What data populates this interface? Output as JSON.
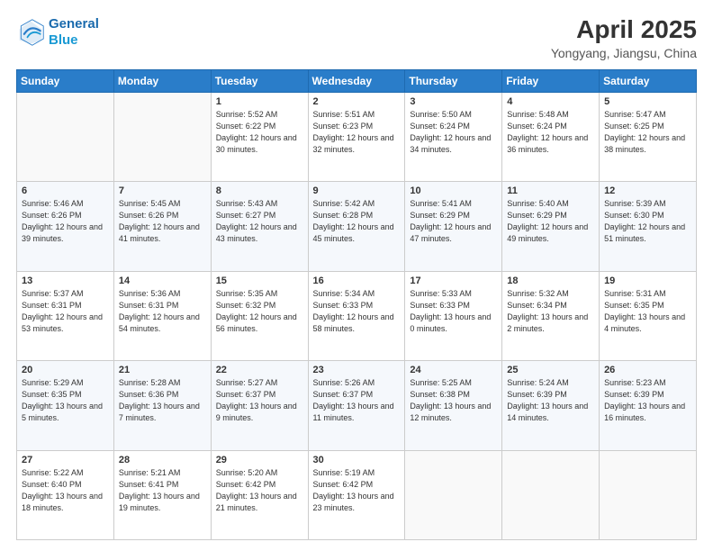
{
  "logo": {
    "line1": "General",
    "line2": "Blue"
  },
  "title": "April 2025",
  "subtitle": "Yongyang, Jiangsu, China",
  "weekdays": [
    "Sunday",
    "Monday",
    "Tuesday",
    "Wednesday",
    "Thursday",
    "Friday",
    "Saturday"
  ],
  "weeks": [
    [
      {
        "day": "",
        "sunrise": "",
        "sunset": "",
        "daylight": ""
      },
      {
        "day": "",
        "sunrise": "",
        "sunset": "",
        "daylight": ""
      },
      {
        "day": "1",
        "sunrise": "Sunrise: 5:52 AM",
        "sunset": "Sunset: 6:22 PM",
        "daylight": "Daylight: 12 hours and 30 minutes."
      },
      {
        "day": "2",
        "sunrise": "Sunrise: 5:51 AM",
        "sunset": "Sunset: 6:23 PM",
        "daylight": "Daylight: 12 hours and 32 minutes."
      },
      {
        "day": "3",
        "sunrise": "Sunrise: 5:50 AM",
        "sunset": "Sunset: 6:24 PM",
        "daylight": "Daylight: 12 hours and 34 minutes."
      },
      {
        "day": "4",
        "sunrise": "Sunrise: 5:48 AM",
        "sunset": "Sunset: 6:24 PM",
        "daylight": "Daylight: 12 hours and 36 minutes."
      },
      {
        "day": "5",
        "sunrise": "Sunrise: 5:47 AM",
        "sunset": "Sunset: 6:25 PM",
        "daylight": "Daylight: 12 hours and 38 minutes."
      }
    ],
    [
      {
        "day": "6",
        "sunrise": "Sunrise: 5:46 AM",
        "sunset": "Sunset: 6:26 PM",
        "daylight": "Daylight: 12 hours and 39 minutes."
      },
      {
        "day": "7",
        "sunrise": "Sunrise: 5:45 AM",
        "sunset": "Sunset: 6:26 PM",
        "daylight": "Daylight: 12 hours and 41 minutes."
      },
      {
        "day": "8",
        "sunrise": "Sunrise: 5:43 AM",
        "sunset": "Sunset: 6:27 PM",
        "daylight": "Daylight: 12 hours and 43 minutes."
      },
      {
        "day": "9",
        "sunrise": "Sunrise: 5:42 AM",
        "sunset": "Sunset: 6:28 PM",
        "daylight": "Daylight: 12 hours and 45 minutes."
      },
      {
        "day": "10",
        "sunrise": "Sunrise: 5:41 AM",
        "sunset": "Sunset: 6:29 PM",
        "daylight": "Daylight: 12 hours and 47 minutes."
      },
      {
        "day": "11",
        "sunrise": "Sunrise: 5:40 AM",
        "sunset": "Sunset: 6:29 PM",
        "daylight": "Daylight: 12 hours and 49 minutes."
      },
      {
        "day": "12",
        "sunrise": "Sunrise: 5:39 AM",
        "sunset": "Sunset: 6:30 PM",
        "daylight": "Daylight: 12 hours and 51 minutes."
      }
    ],
    [
      {
        "day": "13",
        "sunrise": "Sunrise: 5:37 AM",
        "sunset": "Sunset: 6:31 PM",
        "daylight": "Daylight: 12 hours and 53 minutes."
      },
      {
        "day": "14",
        "sunrise": "Sunrise: 5:36 AM",
        "sunset": "Sunset: 6:31 PM",
        "daylight": "Daylight: 12 hours and 54 minutes."
      },
      {
        "day": "15",
        "sunrise": "Sunrise: 5:35 AM",
        "sunset": "Sunset: 6:32 PM",
        "daylight": "Daylight: 12 hours and 56 minutes."
      },
      {
        "day": "16",
        "sunrise": "Sunrise: 5:34 AM",
        "sunset": "Sunset: 6:33 PM",
        "daylight": "Daylight: 12 hours and 58 minutes."
      },
      {
        "day": "17",
        "sunrise": "Sunrise: 5:33 AM",
        "sunset": "Sunset: 6:33 PM",
        "daylight": "Daylight: 13 hours and 0 minutes."
      },
      {
        "day": "18",
        "sunrise": "Sunrise: 5:32 AM",
        "sunset": "Sunset: 6:34 PM",
        "daylight": "Daylight: 13 hours and 2 minutes."
      },
      {
        "day": "19",
        "sunrise": "Sunrise: 5:31 AM",
        "sunset": "Sunset: 6:35 PM",
        "daylight": "Daylight: 13 hours and 4 minutes."
      }
    ],
    [
      {
        "day": "20",
        "sunrise": "Sunrise: 5:29 AM",
        "sunset": "Sunset: 6:35 PM",
        "daylight": "Daylight: 13 hours and 5 minutes."
      },
      {
        "day": "21",
        "sunrise": "Sunrise: 5:28 AM",
        "sunset": "Sunset: 6:36 PM",
        "daylight": "Daylight: 13 hours and 7 minutes."
      },
      {
        "day": "22",
        "sunrise": "Sunrise: 5:27 AM",
        "sunset": "Sunset: 6:37 PM",
        "daylight": "Daylight: 13 hours and 9 minutes."
      },
      {
        "day": "23",
        "sunrise": "Sunrise: 5:26 AM",
        "sunset": "Sunset: 6:37 PM",
        "daylight": "Daylight: 13 hours and 11 minutes."
      },
      {
        "day": "24",
        "sunrise": "Sunrise: 5:25 AM",
        "sunset": "Sunset: 6:38 PM",
        "daylight": "Daylight: 13 hours and 12 minutes."
      },
      {
        "day": "25",
        "sunrise": "Sunrise: 5:24 AM",
        "sunset": "Sunset: 6:39 PM",
        "daylight": "Daylight: 13 hours and 14 minutes."
      },
      {
        "day": "26",
        "sunrise": "Sunrise: 5:23 AM",
        "sunset": "Sunset: 6:39 PM",
        "daylight": "Daylight: 13 hours and 16 minutes."
      }
    ],
    [
      {
        "day": "27",
        "sunrise": "Sunrise: 5:22 AM",
        "sunset": "Sunset: 6:40 PM",
        "daylight": "Daylight: 13 hours and 18 minutes."
      },
      {
        "day": "28",
        "sunrise": "Sunrise: 5:21 AM",
        "sunset": "Sunset: 6:41 PM",
        "daylight": "Daylight: 13 hours and 19 minutes."
      },
      {
        "day": "29",
        "sunrise": "Sunrise: 5:20 AM",
        "sunset": "Sunset: 6:42 PM",
        "daylight": "Daylight: 13 hours and 21 minutes."
      },
      {
        "day": "30",
        "sunrise": "Sunrise: 5:19 AM",
        "sunset": "Sunset: 6:42 PM",
        "daylight": "Daylight: 13 hours and 23 minutes."
      },
      {
        "day": "",
        "sunrise": "",
        "sunset": "",
        "daylight": ""
      },
      {
        "day": "",
        "sunrise": "",
        "sunset": "",
        "daylight": ""
      },
      {
        "day": "",
        "sunrise": "",
        "sunset": "",
        "daylight": ""
      }
    ]
  ]
}
